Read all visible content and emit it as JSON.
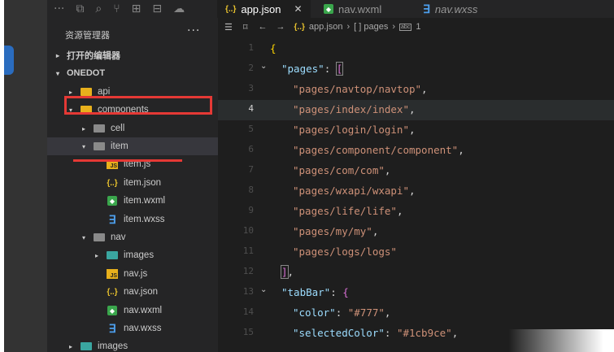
{
  "sidebar": {
    "title": "资源管理器",
    "more": "···",
    "rows": [
      {
        "label": "打开的编辑器",
        "type": "section"
      },
      {
        "label": "ONEDOT",
        "type": "section"
      },
      {
        "label": "api",
        "type": "folder"
      },
      {
        "label": "components",
        "type": "folder"
      },
      {
        "label": "cell",
        "type": "folder"
      },
      {
        "label": "item",
        "type": "folder"
      },
      {
        "label": "item.js",
        "type": "js"
      },
      {
        "label": "item.json",
        "type": "json"
      },
      {
        "label": "item.wxml",
        "type": "wxml"
      },
      {
        "label": "item.wxss",
        "type": "wxss"
      },
      {
        "label": "nav",
        "type": "folder"
      },
      {
        "label": "images",
        "type": "folder"
      },
      {
        "label": "nav.js",
        "type": "js"
      },
      {
        "label": "nav.json",
        "type": "json"
      },
      {
        "label": "nav.wxml",
        "type": "wxml"
      },
      {
        "label": "nav.wxss",
        "type": "wxss"
      },
      {
        "label": "images",
        "type": "folder"
      }
    ]
  },
  "tabs": [
    {
      "label": "app.json",
      "active": true,
      "icon": "json-icon"
    },
    {
      "label": "nav.wxml",
      "active": false,
      "icon": "wxml-icon"
    },
    {
      "label": "nav.wxss",
      "active": false,
      "icon": "wxss-icon"
    }
  ],
  "icons": {
    "json": "{..}",
    "js": "JS",
    "wxss": "∃",
    "wxml": "◆",
    "close": "✕"
  },
  "breadcrumb": {
    "file": "app.json",
    "path1": "[ ] pages",
    "path2": "1"
  },
  "code_lines": [
    {
      "num": "1",
      "text": "{"
    },
    {
      "num": "2",
      "key": "\"pages\"",
      "sep": ": ",
      "open": "["
    },
    {
      "num": "3",
      "str": "\"pages/navtop/navtop\"",
      "tail": ","
    },
    {
      "num": "4",
      "str": "\"pages/index/index\"",
      "tail": ","
    },
    {
      "num": "5",
      "str": "\"pages/login/login\"",
      "tail": ","
    },
    {
      "num": "6",
      "str": "\"pages/component/component\"",
      "tail": ","
    },
    {
      "num": "7",
      "str": "\"pages/com/com\"",
      "tail": ","
    },
    {
      "num": "8",
      "str": "\"pages/wxapi/wxapi\"",
      "tail": ","
    },
    {
      "num": "9",
      "str": "\"pages/life/life\"",
      "tail": ","
    },
    {
      "num": "10",
      "str": "\"pages/my/my\"",
      "tail": ","
    },
    {
      "num": "11",
      "str": "\"pages/logs/logs\"",
      "tail": ""
    },
    {
      "num": "12",
      "close": "]",
      "tail": ","
    },
    {
      "num": "13",
      "key": "\"tabBar\"",
      "sep": ": ",
      "open": "{"
    },
    {
      "num": "14",
      "key": "\"color\"",
      "sep": ": ",
      "val": "\"#777\"",
      "tail": ","
    },
    {
      "num": "15",
      "key": "\"selectedColor\"",
      "sep": ": ",
      "val": "\"#1cb9ce\"",
      "tail": ","
    }
  ],
  "colors": {
    "accent_red": "#e53935",
    "string": "#ce9178",
    "key": "#9cdcfe",
    "bracket_yellow": "#ffd700",
    "bracket_purple": "#da70d6"
  }
}
